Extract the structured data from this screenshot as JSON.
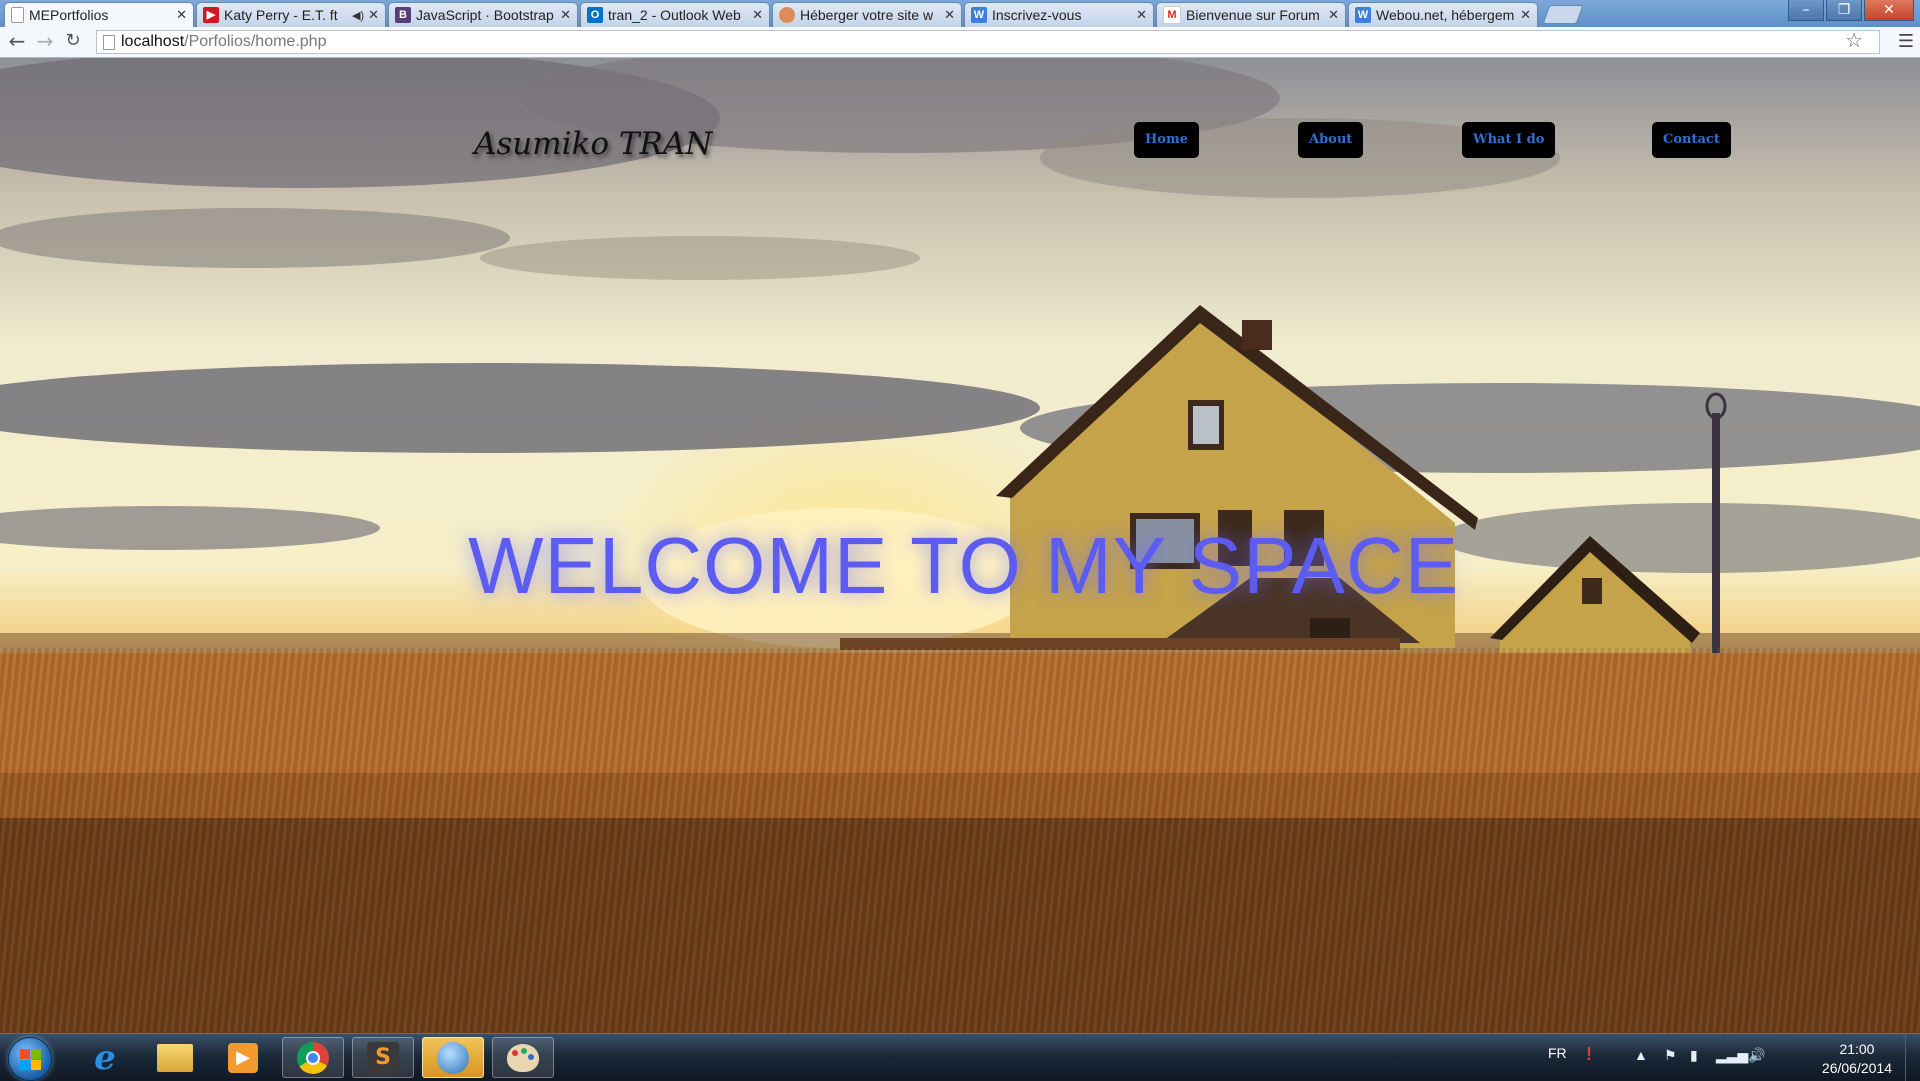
{
  "browser": {
    "tabs": [
      {
        "title": "MEPortfolios",
        "favicon": "page-icon",
        "favicon_color": "#ffffff",
        "active": true
      },
      {
        "title": "Katy Perry - E.T. ft",
        "favicon": "youtube-icon",
        "favicon_color": "#cc181e",
        "muted": true
      },
      {
        "title": "JavaScript · Bootstrap",
        "favicon": "bootstrap-icon",
        "favicon_color": "#563d7c"
      },
      {
        "title": "tran_2 - Outlook Web",
        "favicon": "outlook-icon",
        "favicon_color": "#0072c6"
      },
      {
        "title": "Héberger votre site w",
        "favicon": "host-icon",
        "favicon_color": "#e08a5a"
      },
      {
        "title": "Inscrivez-vous",
        "favicon": "w-icon",
        "favicon_color": "#3b7fd6"
      },
      {
        "title": "Bienvenue sur Forum",
        "favicon": "gmail-icon",
        "favicon_color": "#d93025"
      },
      {
        "title": "Webou.net, hébergem",
        "favicon": "w-icon",
        "favicon_color": "#3b7fd6"
      }
    ],
    "url_host": "localhost",
    "url_path": "/Porfolios/home.php"
  },
  "site": {
    "logo": "Asumiko TRAN",
    "nav": [
      "Home",
      "About",
      "What I do",
      "Contact"
    ],
    "headline": "WELCOME TO MY SPACE"
  },
  "taskbar": {
    "apps": [
      "internet-explorer-icon",
      "folder-icon",
      "media-player-icon",
      "chrome-icon",
      "sublime-icon",
      "network-globe-icon",
      "paint-icon"
    ],
    "lang": "FR",
    "time": "21:00",
    "date": "26/06/2014"
  },
  "colors": {
    "headline": "#5d5cf0",
    "nav_text": "#2f6fd6",
    "nav_bg": "#000000"
  }
}
